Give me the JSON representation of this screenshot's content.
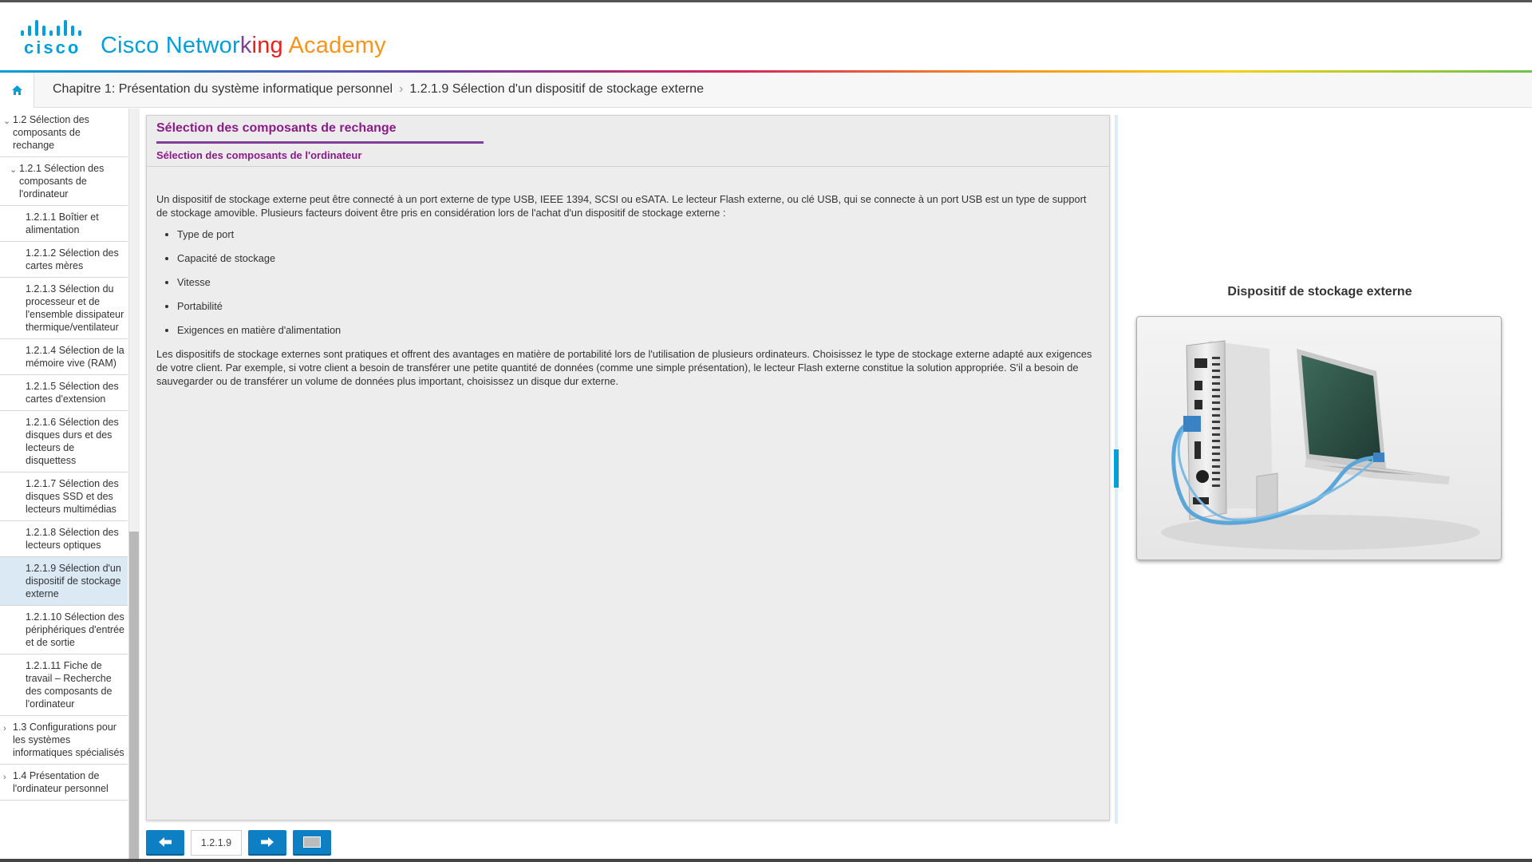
{
  "header": {
    "logo_text": "cisco",
    "brand_parts": [
      "Cisco Networ",
      "k",
      "ing",
      " Academy"
    ],
    "colors": {
      "cisco_blue": "#049fd9",
      "purple": "#7f3f98",
      "red": "#e2231a",
      "orange": "#f7941d"
    }
  },
  "breadcrumb": {
    "home_icon": "home-icon",
    "chapter": "Chapitre 1: Présentation du système informatique personnel",
    "separator": "›",
    "current": "1.2.1.9 Sélection d'un dispositif de stockage externe"
  },
  "sidebar": {
    "items": [
      {
        "label": "1.2 Sélection des composants de rechange",
        "level": 1,
        "chevron": "⌄"
      },
      {
        "label": "1.2.1 Sélection des composants de l'ordinateur",
        "level": 2,
        "chevron": "⌄"
      },
      {
        "label": "1.2.1.1 Boîtier et alimentation",
        "level": 3
      },
      {
        "label": "1.2.1.2 Sélection des cartes mères",
        "level": 3
      },
      {
        "label": "1.2.1.3 Sélection du processeur et de l'ensemble dissipateur thermique/ventilateur",
        "level": 3
      },
      {
        "label": "1.2.1.4 Sélection de la mémoire vive (RAM)",
        "level": 3
      },
      {
        "label": "1.2.1.5 Sélection des cartes d'extension",
        "level": 3
      },
      {
        "label": "1.2.1.6 Sélection des disques durs et des lecteurs de disquettess",
        "level": 3
      },
      {
        "label": "1.2.1.7 Sélection des disques SSD et des lecteurs multimédias",
        "level": 3
      },
      {
        "label": "1.2.1.8 Sélection des lecteurs optiques",
        "level": 3
      },
      {
        "label": "1.2.1.9 Sélection d'un dispositif de stockage externe",
        "level": 3,
        "active": true
      },
      {
        "label": "1.2.1.10 Sélection des périphériques d'entrée et de sortie",
        "level": 3
      },
      {
        "label": "1.2.1.11 Fiche de travail – Recherche des composants de l'ordinateur",
        "level": 3
      },
      {
        "label": "1.3 Configurations pour les systèmes informatiques spécialisés",
        "level": 1,
        "chevron": "›"
      },
      {
        "label": "1.4 Présentation de l'ordinateur personnel",
        "level": 1,
        "chevron": "›"
      }
    ]
  },
  "content": {
    "title": "Sélection des composants de rechange",
    "subtitle": "Sélection des composants de l'ordinateur",
    "intro": "Un dispositif de stockage externe peut être connecté à un port externe de type USB, IEEE 1394, SCSI ou eSATA. Le lecteur Flash externe, ou clé USB, qui se connecte à un port USB est un type de support de stockage amovible. Plusieurs facteurs doivent être pris en considération lors de l'achat d'un dispositif de stockage externe :",
    "bullets": [
      "Type de port",
      "Capacité de stockage",
      "Vitesse",
      "Portabilité",
      "Exigences en matière d'alimentation"
    ],
    "outro": "Les dispositifs de stockage externes sont pratiques et offrent des avantages en matière de portabilité lors de l'utilisation de plusieurs ordinateurs. Choisissez le type de stockage externe adapté aux exigences de votre client. Par exemple, si votre client a besoin de transférer une petite quantité de données (comme une simple présentation), le lecteur Flash externe constitue la solution appropriée. S'il a besoin de sauvegarder ou de transférer un volume de données plus important, choisissez un disque dur externe."
  },
  "figure": {
    "caption": "Dispositif de stockage externe",
    "image_icon": "external-drive-laptop-image"
  },
  "bottom_nav": {
    "prev_icon": "arrow-left-icon",
    "page": "1.2.1.9",
    "next_icon": "arrow-right-icon",
    "fullscreen_icon": "fullscreen-icon"
  }
}
